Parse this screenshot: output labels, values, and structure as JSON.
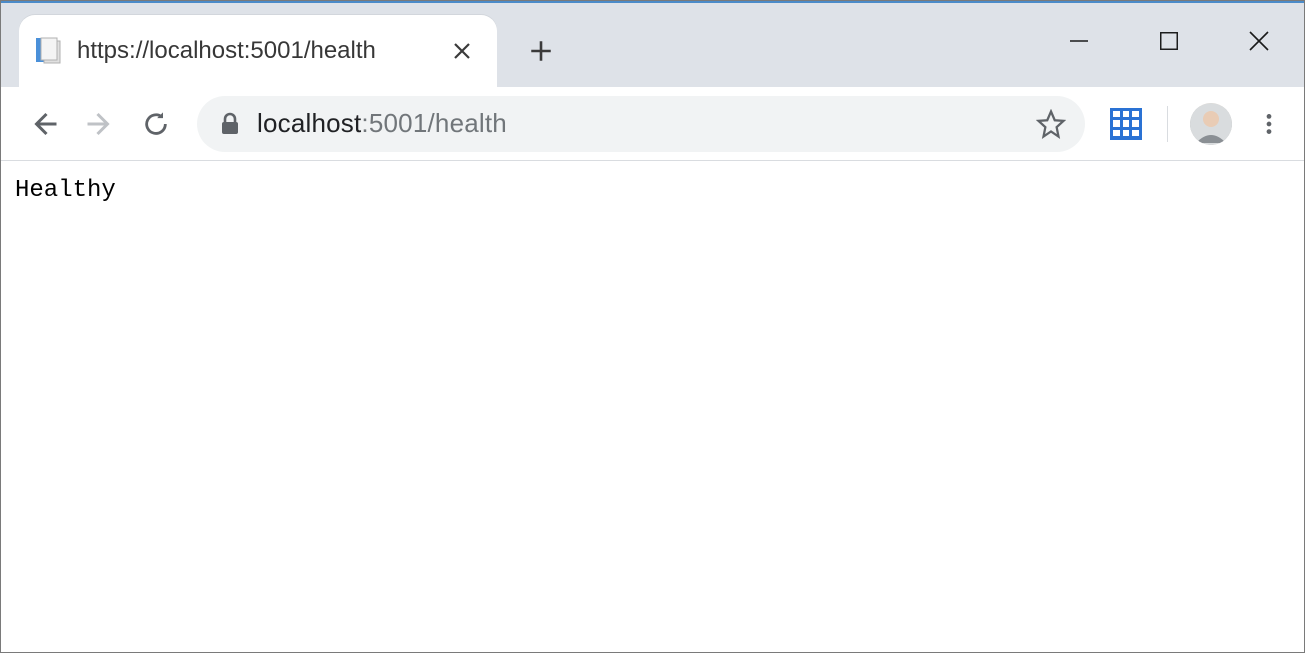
{
  "tab": {
    "title": "https://localhost:5001/health"
  },
  "address": {
    "host": "localhost",
    "rest": ":5001/health"
  },
  "page": {
    "body": "Healthy"
  }
}
